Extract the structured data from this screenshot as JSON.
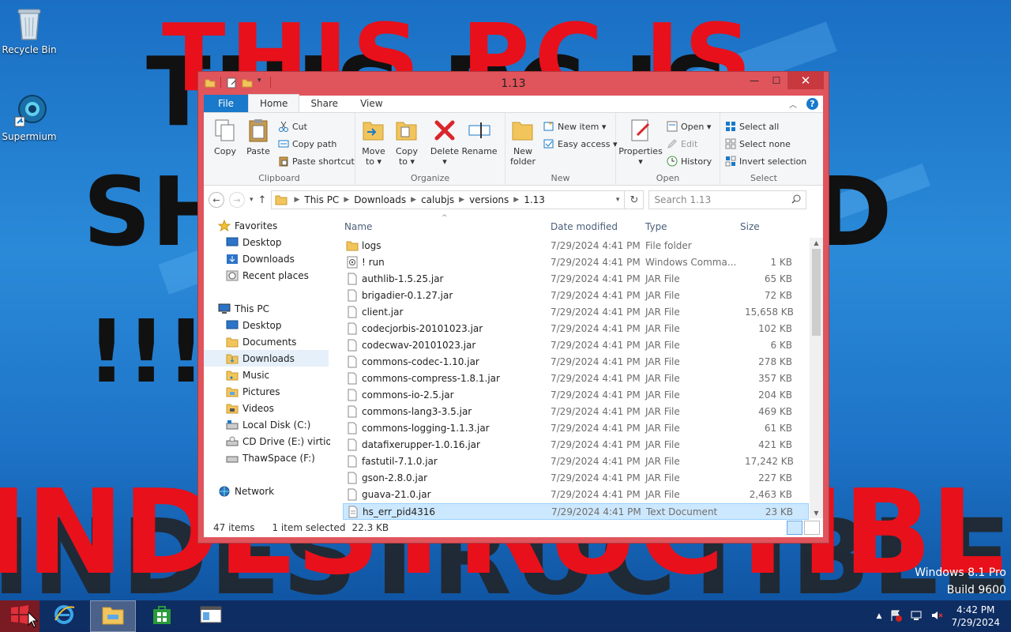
{
  "desktop": {
    "icons": [
      {
        "label": "Recycle Bin",
        "icon": "recycle-bin-icon"
      },
      {
        "label": "Supermium",
        "icon": "supermium-browser-icon"
      }
    ],
    "wallpaper_text": {
      "red_top": "THIS PC IS",
      "black_top": "THIS PC IS",
      "black_mid_left": "SH",
      "black_mid_right": "D",
      "black_excl": "!!!",
      "red_bottom": "INDESTRUCTIBLE",
      "dark_bottom": "INDESTRUCTIBLE"
    },
    "watermark": {
      "line1": "Windows 8.1 Pro",
      "line2": "Build 9600"
    }
  },
  "window": {
    "title": "1.13",
    "controls": {
      "minimize": "—",
      "maximize": "☐",
      "close": "✕"
    },
    "tabs": [
      {
        "label": "File"
      },
      {
        "label": "Home"
      },
      {
        "label": "Share"
      },
      {
        "label": "View"
      }
    ],
    "ribbon": {
      "clipboard": {
        "label": "Clipboard",
        "copy": "Copy",
        "paste": "Paste",
        "cut": "Cut",
        "copy_path": "Copy path",
        "paste_shortcut": "Paste shortcut"
      },
      "organize": {
        "label": "Organize",
        "move_to_1": "Move",
        "move_to_2": "to ▾",
        "copy_to_1": "Copy",
        "copy_to_2": "to ▾",
        "delete": "Delete",
        "delete_arrow": "▾",
        "rename": "Rename"
      },
      "new": {
        "label": "New",
        "new_folder_1": "New",
        "new_folder_2": "folder",
        "new_item": "New item ▾",
        "easy_access": "Easy access ▾"
      },
      "open": {
        "label": "Open",
        "properties": "Properties",
        "properties_arrow": "▾",
        "open": "Open ▾",
        "edit": "Edit",
        "history": "History"
      },
      "select": {
        "label": "Select",
        "select_all": "Select all",
        "select_none": "Select none",
        "invert_selection": "Invert selection"
      }
    },
    "address": {
      "crumbs": [
        "This PC",
        "Downloads",
        "calubjs",
        "versions",
        "1.13"
      ],
      "search_placeholder": "Search 1.13"
    },
    "nav": {
      "favorites": {
        "label": "Favorites",
        "items": [
          "Desktop",
          "Downloads",
          "Recent places"
        ]
      },
      "this_pc": {
        "label": "This PC",
        "items": [
          "Desktop",
          "Documents",
          "Downloads",
          "Music",
          "Pictures",
          "Videos",
          "Local Disk (C:)",
          "CD Drive (E:) virtio-v",
          "ThawSpace (F:)"
        ]
      },
      "network": "Network",
      "selected": "Downloads"
    },
    "columns": {
      "name": "Name",
      "date": "Date modified",
      "type": "Type",
      "size": "Size"
    },
    "files": [
      {
        "name": "logs",
        "date": "7/29/2024 4:41 PM",
        "type": "File folder",
        "size": "",
        "icon": "folder-icon"
      },
      {
        "name": "! run",
        "date": "7/29/2024 4:41 PM",
        "type": "Windows Comma...",
        "size": "1 KB",
        "icon": "batch-file-icon"
      },
      {
        "name": "authlib-1.5.25.jar",
        "date": "7/29/2024 4:41 PM",
        "type": "JAR File",
        "size": "65 KB",
        "icon": "file-icon"
      },
      {
        "name": "brigadier-0.1.27.jar",
        "date": "7/29/2024 4:41 PM",
        "type": "JAR File",
        "size": "72 KB",
        "icon": "file-icon"
      },
      {
        "name": "client.jar",
        "date": "7/29/2024 4:41 PM",
        "type": "JAR File",
        "size": "15,658 KB",
        "icon": "file-icon"
      },
      {
        "name": "codecjorbis-20101023.jar",
        "date": "7/29/2024 4:41 PM",
        "type": "JAR File",
        "size": "102 KB",
        "icon": "file-icon"
      },
      {
        "name": "codecwav-20101023.jar",
        "date": "7/29/2024 4:41 PM",
        "type": "JAR File",
        "size": "6 KB",
        "icon": "file-icon"
      },
      {
        "name": "commons-codec-1.10.jar",
        "date": "7/29/2024 4:41 PM",
        "type": "JAR File",
        "size": "278 KB",
        "icon": "file-icon"
      },
      {
        "name": "commons-compress-1.8.1.jar",
        "date": "7/29/2024 4:41 PM",
        "type": "JAR File",
        "size": "357 KB",
        "icon": "file-icon"
      },
      {
        "name": "commons-io-2.5.jar",
        "date": "7/29/2024 4:41 PM",
        "type": "JAR File",
        "size": "204 KB",
        "icon": "file-icon"
      },
      {
        "name": "commons-lang3-3.5.jar",
        "date": "7/29/2024 4:41 PM",
        "type": "JAR File",
        "size": "469 KB",
        "icon": "file-icon"
      },
      {
        "name": "commons-logging-1.1.3.jar",
        "date": "7/29/2024 4:41 PM",
        "type": "JAR File",
        "size": "61 KB",
        "icon": "file-icon"
      },
      {
        "name": "datafixerupper-1.0.16.jar",
        "date": "7/29/2024 4:41 PM",
        "type": "JAR File",
        "size": "421 KB",
        "icon": "file-icon"
      },
      {
        "name": "fastutil-7.1.0.jar",
        "date": "7/29/2024 4:41 PM",
        "type": "JAR File",
        "size": "17,242 KB",
        "icon": "file-icon"
      },
      {
        "name": "gson-2.8.0.jar",
        "date": "7/29/2024 4:41 PM",
        "type": "JAR File",
        "size": "227 KB",
        "icon": "file-icon"
      },
      {
        "name": "guava-21.0.jar",
        "date": "7/29/2024 4:41 PM",
        "type": "JAR File",
        "size": "2,463 KB",
        "icon": "file-icon"
      },
      {
        "name": "hs_err_pid4316",
        "date": "7/29/2024 4:41 PM",
        "type": "Text Document",
        "size": "23 KB",
        "icon": "text-file-icon",
        "selected": true
      }
    ],
    "status": {
      "items": "47 items",
      "selection": "1 item selected",
      "size": "22.3 KB"
    }
  },
  "taskbar": {
    "apps": [
      {
        "icon": "start-icon"
      },
      {
        "icon": "internet-explorer-icon"
      },
      {
        "icon": "file-explorer-icon",
        "active": true
      },
      {
        "icon": "store-icon"
      },
      {
        "icon": "window-app-icon"
      }
    ],
    "clock": {
      "time": "4:42 PM",
      "date": "7/29/2024"
    }
  },
  "colors": {
    "window_frame": "#e0545c",
    "close_button": "#c7393f",
    "file_tab": "#1979ca",
    "selection": "#cce8ff",
    "wallpaper_red": "#e8101a"
  }
}
